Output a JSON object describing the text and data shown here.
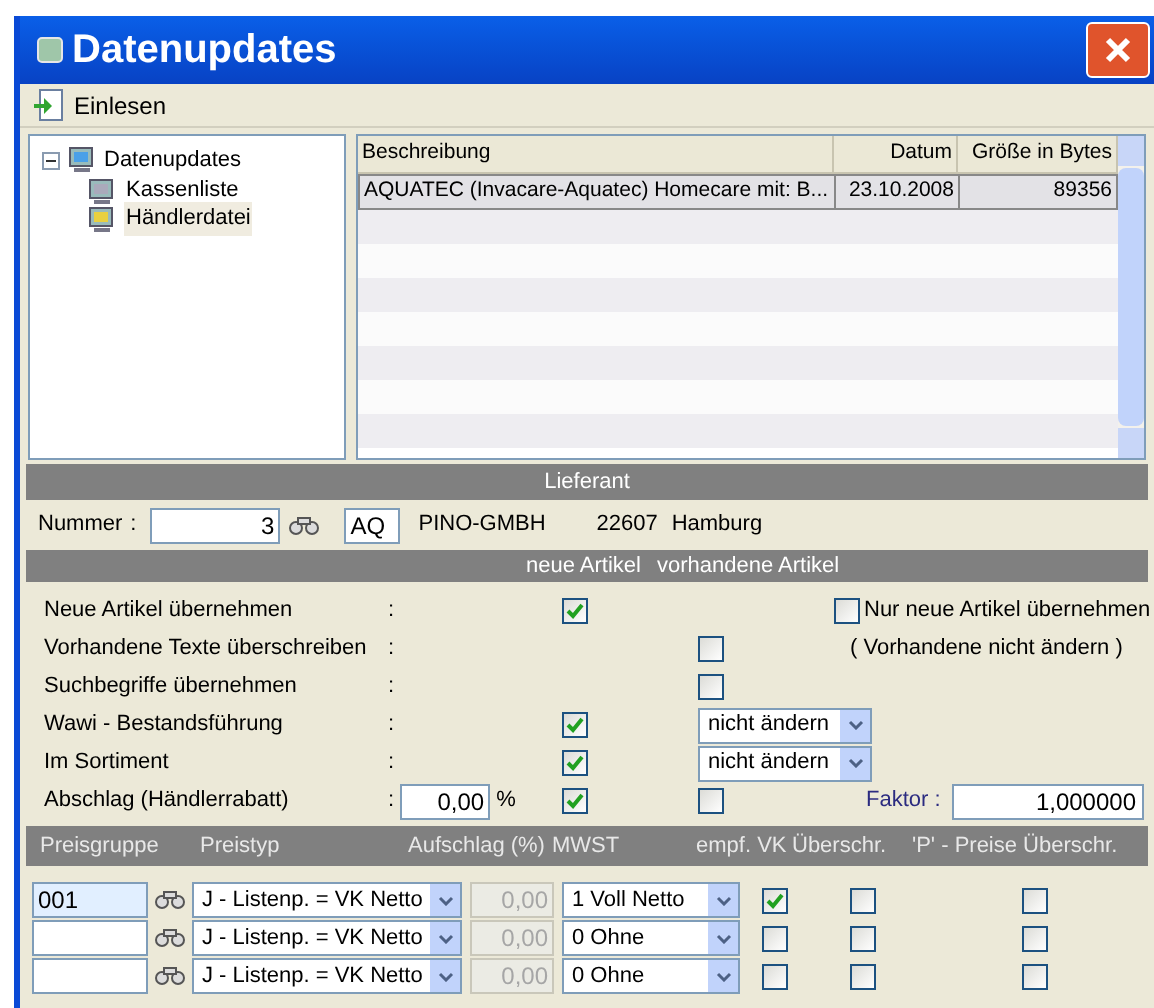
{
  "window": {
    "title": "Datenupdates"
  },
  "toolbar": [
    {
      "label": "Einlesen"
    }
  ],
  "tree": {
    "label": "Datenupdates",
    "expanded": true,
    "children": [
      {
        "label": "Kassenliste",
        "selected": false
      },
      {
        "label": "Händlerdatei",
        "selected": true
      }
    ]
  },
  "table": {
    "columns": [
      "Beschreibung",
      "Datum",
      "Größe in Bytes"
    ],
    "rows": [
      {
        "cells": [
          "AQUATEC (Invacare-Aquatec) Homecare mit: B...",
          "23.10.2008",
          "89356"
        ],
        "selected": true
      }
    ]
  },
  "supplier": {
    "title": "Lieferant",
    "number_label": "Nummer",
    "separator": ":",
    "number": "3",
    "code": "AQ",
    "name": "PINO-GMBH",
    "zip": "22607",
    "city": "Hamburg"
  },
  "options": {
    "headers": [
      "neue Artikel",
      "vorhandene Artikel"
    ],
    "rows": [
      {
        "label": "Neue Artikel übernehmen",
        "separator": ":",
        "new": {
          "kind": "checkbox",
          "checked": true
        },
        "existing": {
          "kind": "none"
        },
        "extra": {
          "kind": "checkbox",
          "checked": false,
          "label": "Nur neue Artikel übernehmen"
        }
      },
      {
        "label": "Vorhandene Texte überschreiben",
        "separator": ":",
        "new": {
          "kind": "none"
        },
        "existing": {
          "kind": "checkbox",
          "checked": false
        },
        "extra": {
          "kind": "note",
          "text": "( Vorhandene nicht ändern )"
        }
      },
      {
        "label": "Suchbegriffe übernehmen",
        "separator": ":",
        "new": {
          "kind": "none"
        },
        "existing": {
          "kind": "checkbox",
          "checked": false
        },
        "extra": {
          "kind": "none"
        }
      },
      {
        "label": "Wawi - Bestandsführung",
        "separator": ":",
        "new": {
          "kind": "checkbox",
          "checked": true
        },
        "existing": {
          "kind": "select",
          "value": "nicht ändern"
        },
        "extra": {
          "kind": "none"
        }
      },
      {
        "label": "Im Sortiment",
        "separator": ":",
        "new": {
          "kind": "checkbox",
          "checked": true
        },
        "existing": {
          "kind": "select",
          "value": "nicht ändern"
        },
        "extra": {
          "kind": "none"
        }
      },
      {
        "label": "Abschlag (Händlerrabatt)",
        "separator": ":",
        "input": {
          "value": "0,00",
          "unit": "%"
        },
        "new": {
          "kind": "checkbox",
          "checked": true
        },
        "existing": {
          "kind": "checkbox",
          "checked": false
        },
        "extra": {
          "kind": "field",
          "label": "Faktor :",
          "value": "1,000000"
        }
      }
    ]
  },
  "prices": {
    "columns": [
      "Preisgruppe",
      "Preistyp",
      "Aufschlag (%)",
      "MWST",
      "empf. VK",
      "Überschr.",
      "'P' - Preise Überschr."
    ],
    "rows": [
      {
        "group": "001",
        "focused": true,
        "type": "J - Listenp. = VK Netto",
        "surcharge": "0,00",
        "vat": "1 Voll Netto",
        "recommended": true,
        "override": false,
        "p_override": false
      },
      {
        "group": "",
        "focused": false,
        "type": "J - Listenp. = VK Netto",
        "surcharge": "0,00",
        "vat": "0 Ohne",
        "recommended": false,
        "override": false,
        "p_override": false
      },
      {
        "group": "",
        "focused": false,
        "type": "J - Listenp. = VK Netto",
        "surcharge": "0,00",
        "vat": "0 Ohne",
        "recommended": false,
        "override": false,
        "p_override": false
      }
    ]
  }
}
